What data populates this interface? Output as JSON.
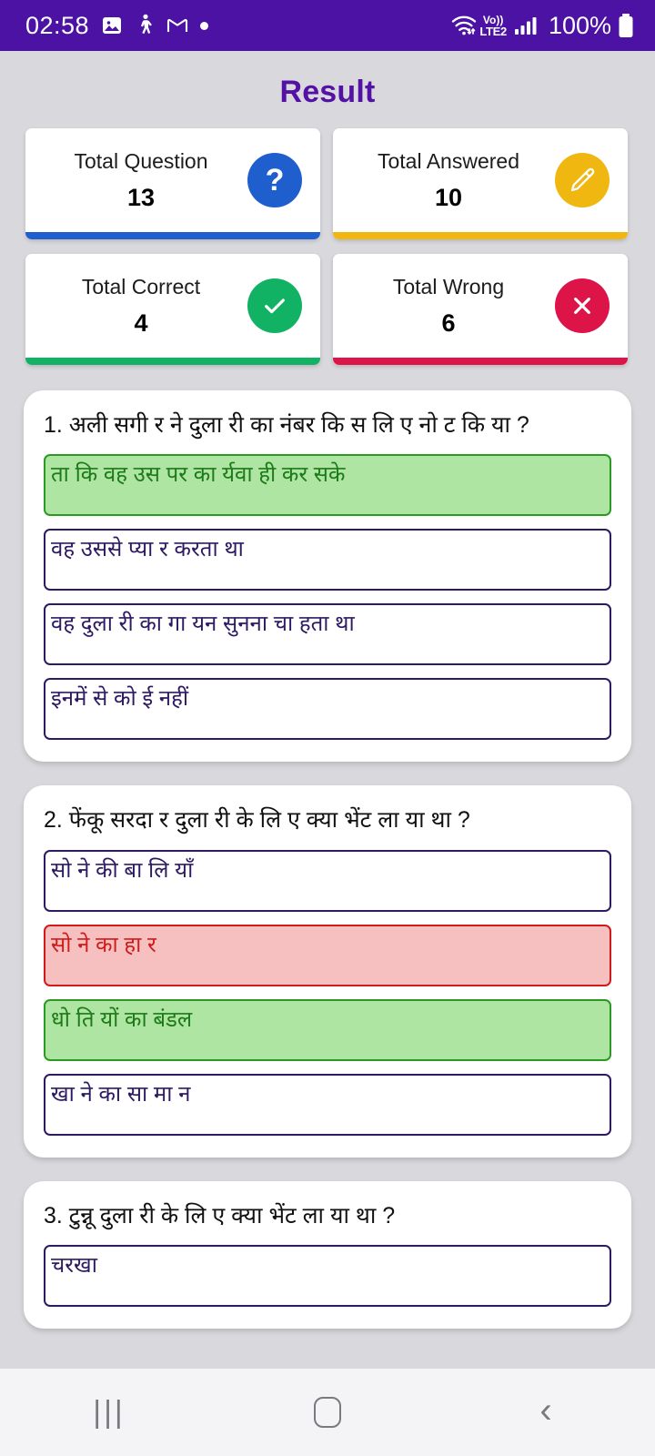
{
  "status_bar": {
    "time": "02:58",
    "icons_left": [
      "image-icon",
      "walking-icon",
      "gmail-icon",
      "dot-icon"
    ],
    "network_label_top": "Vo))",
    "network_label_bottom": "LTE2",
    "battery_percent": "100%",
    "icons_right": [
      "wifi-icon",
      "volte-icon",
      "signal-icon",
      "battery-icon"
    ],
    "background_color": "#4b12a4"
  },
  "header": {
    "title": "Result",
    "title_color": "#5312a5"
  },
  "stats": [
    {
      "label": "Total Question",
      "value": "13",
      "icon": "question-mark-icon",
      "color": "#1f5fcd"
    },
    {
      "label": "Total Answered",
      "value": "10",
      "icon": "pencil-icon",
      "color": "#f0b710"
    },
    {
      "label": "Total Correct",
      "value": "4",
      "icon": "check-icon",
      "color": "#12b265"
    },
    {
      "label": "Total Wrong",
      "value": "6",
      "icon": "close-icon",
      "color": "#dc1448"
    }
  ],
  "questions": [
    {
      "text": "1. अली सगी र ने दुला री का नंबर कि स लि ए नो ट कि या ?",
      "options": [
        {
          "text": "ता कि वह उस पर का र्यवा ही कर सके",
          "state": "correct"
        },
        {
          "text": "वह उससे प्या र करता था",
          "state": "neutral"
        },
        {
          "text": "वह दुला री का गा यन सुनना चा हता था",
          "state": "neutral"
        },
        {
          "text": "इनमें से को ई नहीं",
          "state": "neutral"
        }
      ]
    },
    {
      "text": "2. फेंकू सरदा र दुला री के लि ए क्या भेंट ला या था ?",
      "options": [
        {
          "text": "सो ने की बा लि याँ",
          "state": "neutral"
        },
        {
          "text": "सो ने का हा र",
          "state": "wrong"
        },
        {
          "text": "धो ति यों का बंडल",
          "state": "correct"
        },
        {
          "text": "खा ने का सा मा न",
          "state": "neutral"
        }
      ]
    },
    {
      "text": "3. टुन्नू दुला री के लि ए क्या भेंट ला या था ?",
      "options": [
        {
          "text": "चरखा",
          "state": "neutral"
        }
      ]
    }
  ],
  "nav_bar": {
    "recents_label": "|||",
    "home_label": "",
    "back_label": "‹",
    "items": [
      "recents-button",
      "home-button",
      "back-button"
    ]
  },
  "colors": {
    "page_background": "#d8d8dd",
    "card_background": "#ffffff",
    "option_border": "#2d1a63",
    "correct_bg": "#aee5a2",
    "correct_border": "#2a9a23",
    "wrong_bg": "#f6c0c0",
    "wrong_border": "#d01b1b"
  }
}
